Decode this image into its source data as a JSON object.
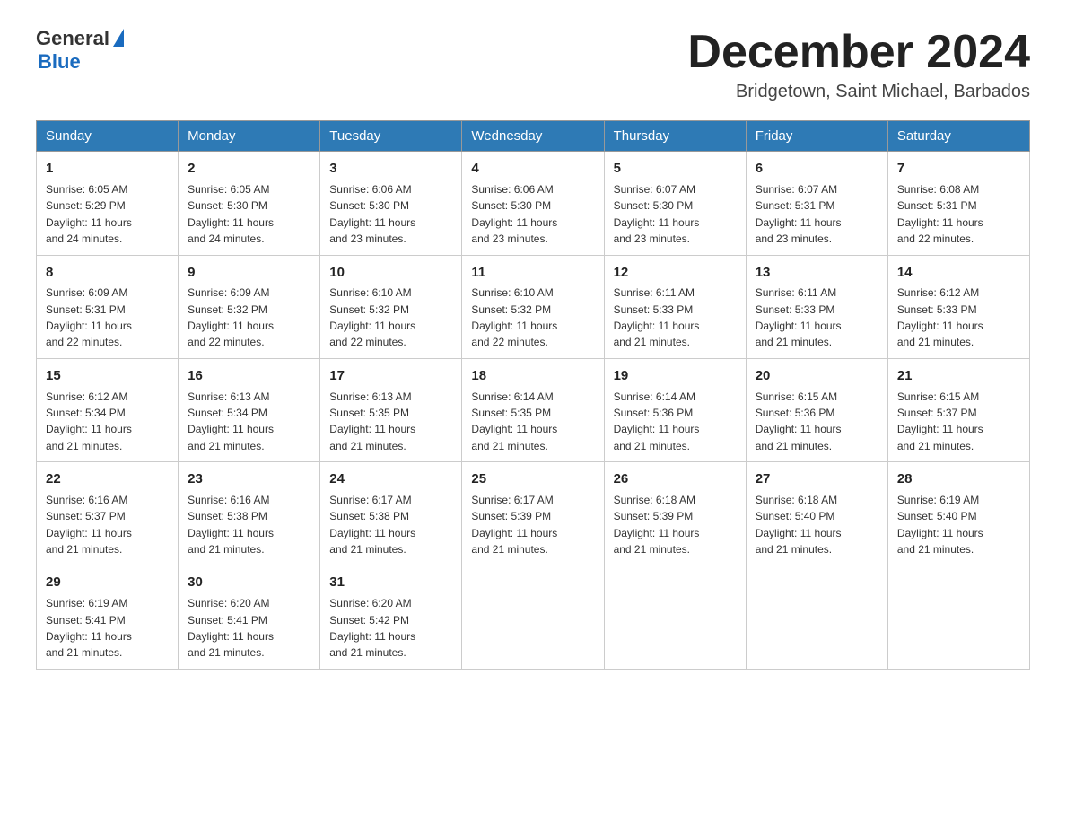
{
  "logo": {
    "general": "General",
    "blue": "Blue"
  },
  "title": {
    "month_year": "December 2024",
    "location": "Bridgetown, Saint Michael, Barbados"
  },
  "headers": [
    "Sunday",
    "Monday",
    "Tuesday",
    "Wednesday",
    "Thursday",
    "Friday",
    "Saturday"
  ],
  "weeks": [
    [
      {
        "day": "1",
        "sunrise": "6:05 AM",
        "sunset": "5:29 PM",
        "daylight": "11 hours and 24 minutes."
      },
      {
        "day": "2",
        "sunrise": "6:05 AM",
        "sunset": "5:30 PM",
        "daylight": "11 hours and 24 minutes."
      },
      {
        "day": "3",
        "sunrise": "6:06 AM",
        "sunset": "5:30 PM",
        "daylight": "11 hours and 23 minutes."
      },
      {
        "day": "4",
        "sunrise": "6:06 AM",
        "sunset": "5:30 PM",
        "daylight": "11 hours and 23 minutes."
      },
      {
        "day": "5",
        "sunrise": "6:07 AM",
        "sunset": "5:30 PM",
        "daylight": "11 hours and 23 minutes."
      },
      {
        "day": "6",
        "sunrise": "6:07 AM",
        "sunset": "5:31 PM",
        "daylight": "11 hours and 23 minutes."
      },
      {
        "day": "7",
        "sunrise": "6:08 AM",
        "sunset": "5:31 PM",
        "daylight": "11 hours and 22 minutes."
      }
    ],
    [
      {
        "day": "8",
        "sunrise": "6:09 AM",
        "sunset": "5:31 PM",
        "daylight": "11 hours and 22 minutes."
      },
      {
        "day": "9",
        "sunrise": "6:09 AM",
        "sunset": "5:32 PM",
        "daylight": "11 hours and 22 minutes."
      },
      {
        "day": "10",
        "sunrise": "6:10 AM",
        "sunset": "5:32 PM",
        "daylight": "11 hours and 22 minutes."
      },
      {
        "day": "11",
        "sunrise": "6:10 AM",
        "sunset": "5:32 PM",
        "daylight": "11 hours and 22 minutes."
      },
      {
        "day": "12",
        "sunrise": "6:11 AM",
        "sunset": "5:33 PM",
        "daylight": "11 hours and 21 minutes."
      },
      {
        "day": "13",
        "sunrise": "6:11 AM",
        "sunset": "5:33 PM",
        "daylight": "11 hours and 21 minutes."
      },
      {
        "day": "14",
        "sunrise": "6:12 AM",
        "sunset": "5:33 PM",
        "daylight": "11 hours and 21 minutes."
      }
    ],
    [
      {
        "day": "15",
        "sunrise": "6:12 AM",
        "sunset": "5:34 PM",
        "daylight": "11 hours and 21 minutes."
      },
      {
        "day": "16",
        "sunrise": "6:13 AM",
        "sunset": "5:34 PM",
        "daylight": "11 hours and 21 minutes."
      },
      {
        "day": "17",
        "sunrise": "6:13 AM",
        "sunset": "5:35 PM",
        "daylight": "11 hours and 21 minutes."
      },
      {
        "day": "18",
        "sunrise": "6:14 AM",
        "sunset": "5:35 PM",
        "daylight": "11 hours and 21 minutes."
      },
      {
        "day": "19",
        "sunrise": "6:14 AM",
        "sunset": "5:36 PM",
        "daylight": "11 hours and 21 minutes."
      },
      {
        "day": "20",
        "sunrise": "6:15 AM",
        "sunset": "5:36 PM",
        "daylight": "11 hours and 21 minutes."
      },
      {
        "day": "21",
        "sunrise": "6:15 AM",
        "sunset": "5:37 PM",
        "daylight": "11 hours and 21 minutes."
      }
    ],
    [
      {
        "day": "22",
        "sunrise": "6:16 AM",
        "sunset": "5:37 PM",
        "daylight": "11 hours and 21 minutes."
      },
      {
        "day": "23",
        "sunrise": "6:16 AM",
        "sunset": "5:38 PM",
        "daylight": "11 hours and 21 minutes."
      },
      {
        "day": "24",
        "sunrise": "6:17 AM",
        "sunset": "5:38 PM",
        "daylight": "11 hours and 21 minutes."
      },
      {
        "day": "25",
        "sunrise": "6:17 AM",
        "sunset": "5:39 PM",
        "daylight": "11 hours and 21 minutes."
      },
      {
        "day": "26",
        "sunrise": "6:18 AM",
        "sunset": "5:39 PM",
        "daylight": "11 hours and 21 minutes."
      },
      {
        "day": "27",
        "sunrise": "6:18 AM",
        "sunset": "5:40 PM",
        "daylight": "11 hours and 21 minutes."
      },
      {
        "day": "28",
        "sunrise": "6:19 AM",
        "sunset": "5:40 PM",
        "daylight": "11 hours and 21 minutes."
      }
    ],
    [
      {
        "day": "29",
        "sunrise": "6:19 AM",
        "sunset": "5:41 PM",
        "daylight": "11 hours and 21 minutes."
      },
      {
        "day": "30",
        "sunrise": "6:20 AM",
        "sunset": "5:41 PM",
        "daylight": "11 hours and 21 minutes."
      },
      {
        "day": "31",
        "sunrise": "6:20 AM",
        "sunset": "5:42 PM",
        "daylight": "11 hours and 21 minutes."
      },
      null,
      null,
      null,
      null
    ]
  ],
  "labels": {
    "sunrise": "Sunrise:",
    "sunset": "Sunset:",
    "daylight": "Daylight:"
  }
}
